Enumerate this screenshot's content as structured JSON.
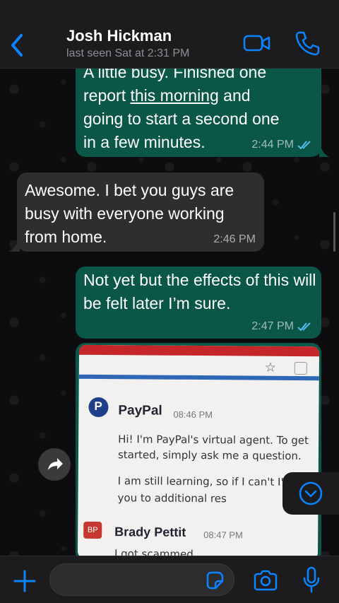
{
  "header": {
    "contact_name": "Josh Hickman",
    "status": "last seen Sat at 2:31 PM",
    "accent_color": "#0a84ff",
    "icons": [
      "back-chevron-icon",
      "video-camera-icon",
      "phone-icon"
    ]
  },
  "messages": [
    {
      "direction": "outgoing",
      "line1": "A little busy. Finished one",
      "line2_a": "report ",
      "line2_link": "this morning",
      "line2_b": " and",
      "line3": "going to start a second one",
      "line4": "in a few minutes.",
      "time": "2:44 PM",
      "status": "read"
    },
    {
      "direction": "incoming",
      "text": "Awesome. I bet you guys are busy with everyone working from home.",
      "time": "2:46 PM"
    },
    {
      "direction": "outgoing",
      "text": "Not yet but the effects of this will be felt later I’m sure.",
      "time": "2:47 PM",
      "status": "read"
    }
  ],
  "image_message": {
    "paypal_name": "PayPal",
    "paypal_logo": "P",
    "paypal_time": "08:46 PM",
    "paypal_msg1": "Hi! I'm PayPal's virtual agent. To get started, simply ask me a question.",
    "paypal_msg2": "I am still learning, so if I can't I'll direct you to additional res",
    "user_initials": "BP",
    "user_name": "Brady Pettit",
    "user_time": "08:47 PM",
    "user_msg": "I got scammed"
  },
  "input": {
    "placeholder": "",
    "value": ""
  },
  "colors": {
    "outgoing_bubble": "#0b5747",
    "incoming_bubble": "#2e2e30",
    "read_ticks": "#53bdeb"
  }
}
